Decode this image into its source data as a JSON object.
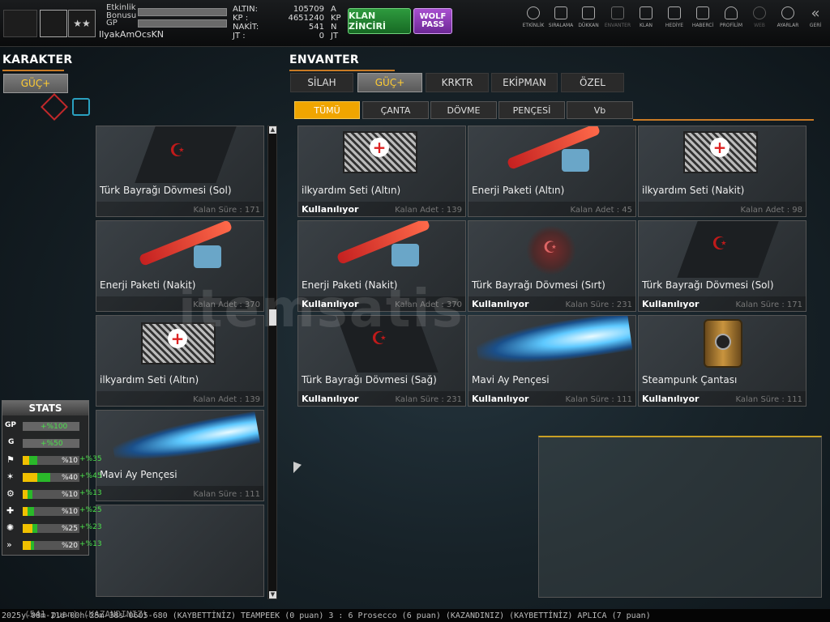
{
  "topbar": {
    "etkinlik_bonusu": "Etkinlik\nBonusu",
    "gp": "GP",
    "username": "IlyakAmOcsKN",
    "currencies": [
      {
        "label": "ALTIN:",
        "value": "105709",
        "unit": "A"
      },
      {
        "label": "KP :",
        "value": "4651240",
        "unit": "KP"
      },
      {
        "label": "NAKİT:",
        "value": "541",
        "unit": "N"
      },
      {
        "label": "JT :",
        "value": "0",
        "unit": "JT"
      }
    ],
    "klan_zinciri": "KLAN ZİNCİRİ",
    "wolf_pass": "WOLF PASS",
    "nav": [
      "ETKİNLİK",
      "SIRALAMA",
      "DÜKKAN",
      "ENVANTER",
      "KLAN",
      "HEDİYE",
      "HABERCİ",
      "PROFİLİM",
      "WEB",
      "AYARLAR",
      "GERİ"
    ]
  },
  "karakter": {
    "title": "KARAKTER",
    "tab": "GÜÇ+"
  },
  "envanter": {
    "title": "ENVANTER",
    "tabs": [
      "SİLAH",
      "GÜÇ+",
      "KRKTR",
      "EKİPMAN",
      "ÖZEL"
    ],
    "subtabs": [
      "TÜMÜ",
      "ÇANTA",
      "DÖVME",
      "PENÇESİ",
      "Vb"
    ]
  },
  "left_items": [
    {
      "name": "Türk Bayrağı Dövmesi (Sol)",
      "meta": "Kalan Süre : 171"
    },
    {
      "name": "Enerji Paketi (Nakit)",
      "meta": "Kalan Adet : 370"
    },
    {
      "name": "ilkyardım Seti (Altın)",
      "meta": "Kalan Adet : 139"
    },
    {
      "name": "Mavi Ay Pençesi",
      "meta": "Kalan Süre : 111"
    },
    {
      "name": "",
      "meta": ""
    }
  ],
  "grid_items": [
    {
      "name": "ilkyardım Seti (Altın)",
      "status": "Kullanılıyor",
      "meta": "Kalan Adet : 139"
    },
    {
      "name": "Enerji Paketi (Altın)",
      "status": "",
      "meta": "Kalan Adet : 45"
    },
    {
      "name": "ilkyardım Seti (Nakit)",
      "status": "",
      "meta": "Kalan Adet : 98"
    },
    {
      "name": "Enerji Paketi (Nakit)",
      "status": "Kullanılıyor",
      "meta": "Kalan Adet : 370"
    },
    {
      "name": "Türk Bayrağı Dövmesi (Sırt)",
      "status": "Kullanılıyor",
      "meta": "Kalan Süre : 231"
    },
    {
      "name": "Türk Bayrağı Dövmesi (Sol)",
      "status": "Kullanılıyor",
      "meta": "Kalan Süre : 171"
    },
    {
      "name": "Türk Bayrağı Dövmesi (Sağ)",
      "status": "Kullanılıyor",
      "meta": "Kalan Süre : 231"
    },
    {
      "name": "Mavi Ay Pençesi",
      "status": "Kullanılıyor",
      "meta": "Kalan Süre : 111"
    },
    {
      "name": "Steampunk Çantası",
      "status": "Kullanılıyor",
      "meta": "Kalan Süre : 111"
    }
  ],
  "stats": {
    "title": "STATS",
    "rows": [
      {
        "label": "GP",
        "value": "+%100",
        "bonus": ""
      },
      {
        "label": "G",
        "value": "+%50",
        "bonus": ""
      },
      {
        "label": "",
        "value": "%10",
        "bonus": "+%35"
      },
      {
        "label": "",
        "value": "%40",
        "bonus": "+%45"
      },
      {
        "label": "",
        "value": "%10",
        "bonus": "+%13"
      },
      {
        "label": "",
        "value": "%10",
        "bonus": "+%25"
      },
      {
        "label": "",
        "value": "%25",
        "bonus": "+%23"
      },
      {
        "label": "",
        "value": "%20",
        "bonus": "+%13"
      }
    ]
  },
  "ticker": "2025y-08m-21d-00h-25m-38s-0605-680    (KAYBETTİNİZ) TEAMPEEK (0 puan) 3 : 6 Prosecco (6 puan) (KAZANDINIZ)          (KAYBETTİNİZ) APLICA (7 puan)",
  "ticker_left": "(541 puan) (KAZANDINIZ)",
  "watermark": "itemsatis"
}
